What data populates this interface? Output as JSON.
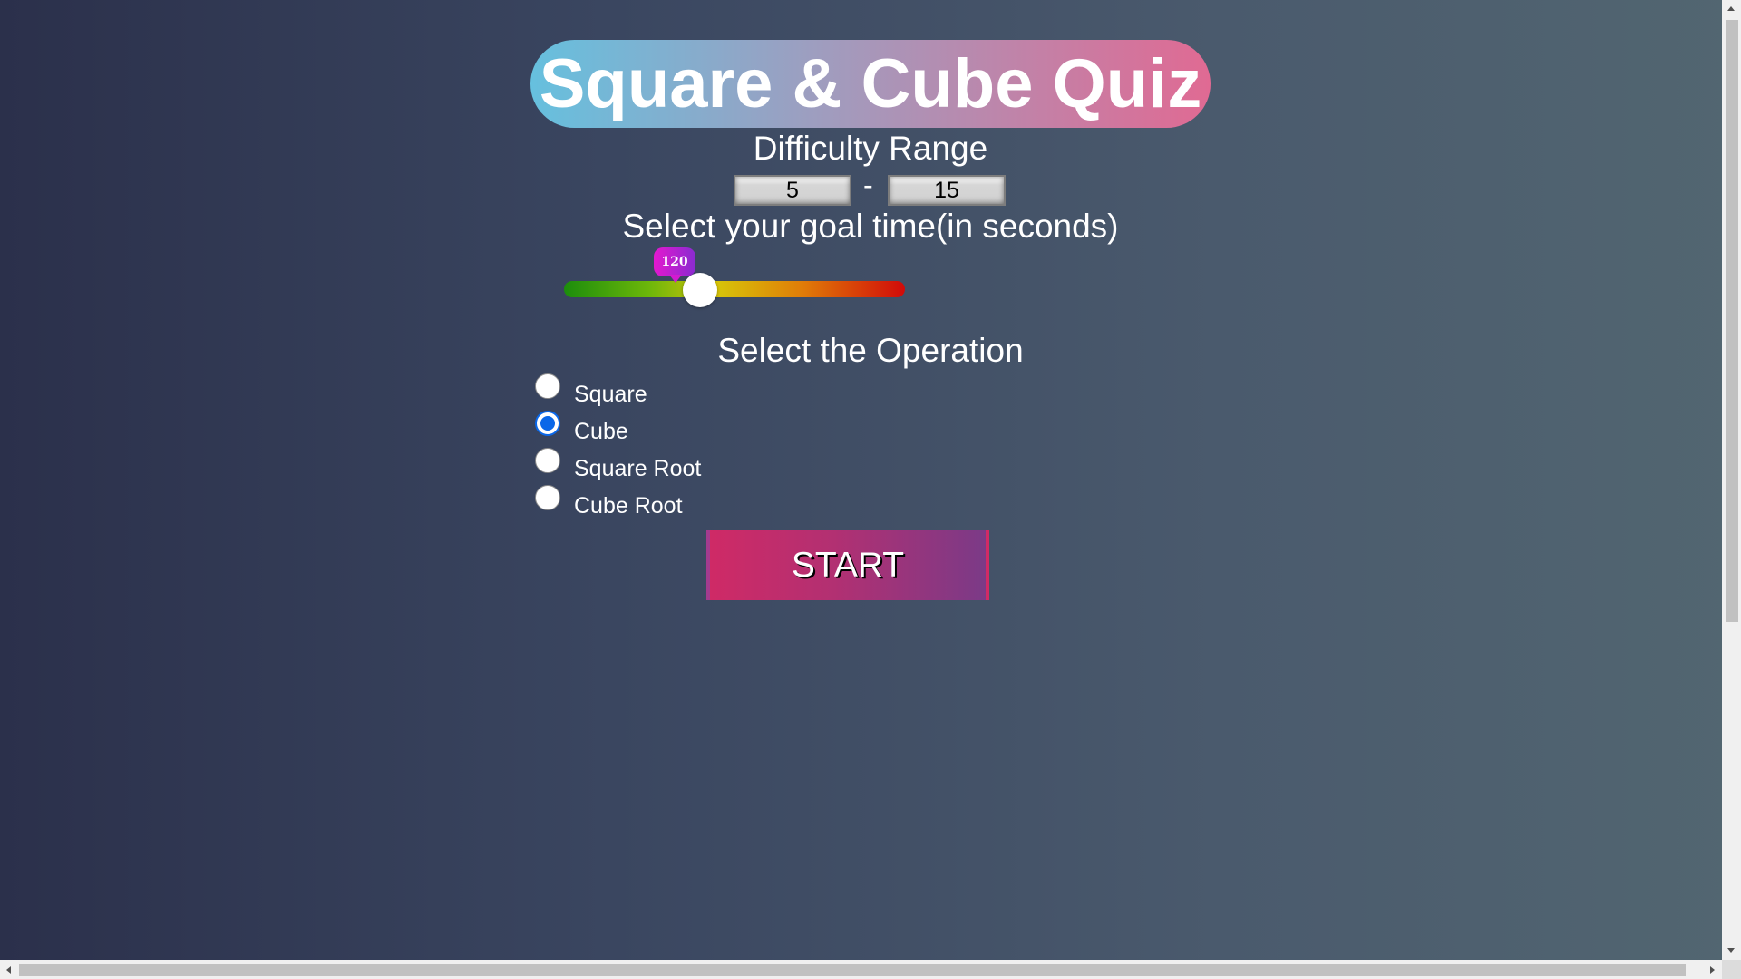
{
  "header": {
    "title": "Square & Cube Quiz"
  },
  "difficulty": {
    "heading": "Difficulty Range",
    "min_value": "5",
    "max_value": "15",
    "separator": "-"
  },
  "goal_time": {
    "heading": "Select your goal time(in seconds)",
    "value": "120",
    "slider_fraction": 0.39
  },
  "operation": {
    "heading": "Select the Operation",
    "options": [
      {
        "label": "Square",
        "checked": false
      },
      {
        "label": "Cube",
        "checked": true
      },
      {
        "label": "Square Root",
        "checked": false
      },
      {
        "label": "Cube Root",
        "checked": false
      }
    ]
  },
  "actions": {
    "start_label": "START"
  },
  "colors": {
    "accent_blue": "#0a67e8",
    "button_pink": "#cf2a66",
    "button_purple": "#7b3a87",
    "bubble_magenta": "#e318cf"
  }
}
